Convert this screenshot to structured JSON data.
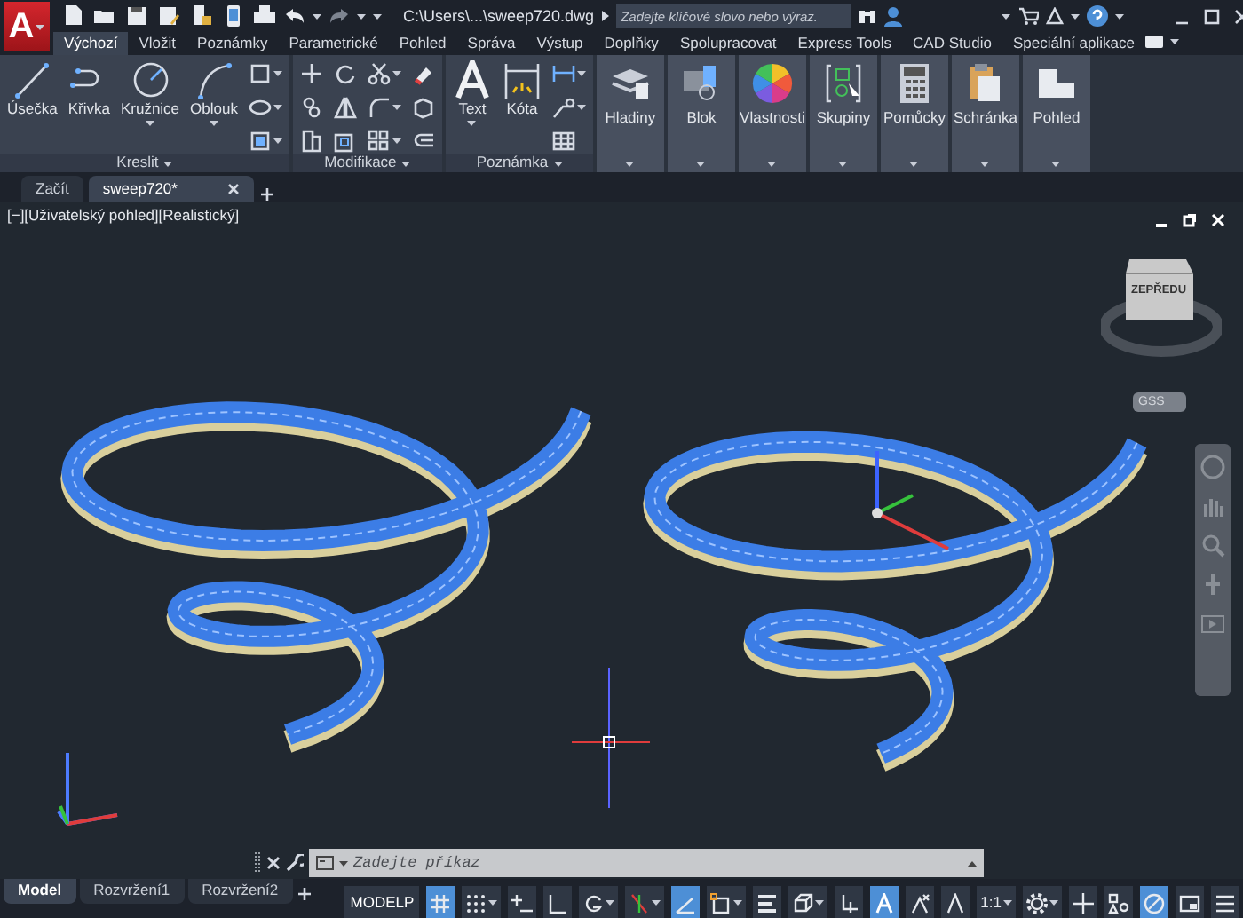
{
  "title_bar": {
    "app_button": {
      "label": "A"
    },
    "title": "C:\\Users\\...\\sweep720.dwg",
    "search": {
      "placeholder": "Zadejte klíčové slovo nebo výraz."
    }
  },
  "ribbon_tabs": [
    {
      "label": "Výchozí",
      "selected": true
    },
    {
      "label": "Vložit",
      "selected": false
    },
    {
      "label": "Poznámky",
      "selected": false
    },
    {
      "label": "Parametrické",
      "selected": false
    },
    {
      "label": "Pohled",
      "selected": false
    },
    {
      "label": "Správa",
      "selected": false
    },
    {
      "label": "Výstup",
      "selected": false
    },
    {
      "label": "Doplňky",
      "selected": false
    },
    {
      "label": "Spolupracovat",
      "selected": false
    },
    {
      "label": "Express Tools",
      "selected": false
    },
    {
      "label": "CAD Studio",
      "selected": false
    },
    {
      "label": "Speciální aplikace",
      "selected": false
    }
  ],
  "ribbon_panels": [
    {
      "kind": "draw",
      "title": "Kreslit",
      "large_tools": [
        {
          "label": "Úsečka",
          "menu": false
        },
        {
          "label": "Křivka",
          "menu": false
        },
        {
          "label": "Kružnice",
          "menu": true
        },
        {
          "label": "Oblouk",
          "menu": true
        }
      ]
    },
    {
      "kind": "modify",
      "title": "Modifikace"
    },
    {
      "kind": "annotate",
      "title": "Poznámka",
      "large_tools": [
        {
          "label": "Text",
          "menu": true
        },
        {
          "label": "Kóta",
          "menu": false
        }
      ]
    }
  ],
  "collapsed_panels": [
    {
      "label": "Hladiny"
    },
    {
      "label": "Blok"
    },
    {
      "label": "Vlastnosti"
    },
    {
      "label": "Skupiny"
    },
    {
      "label": "Pomůcky"
    },
    {
      "label": "Schránka"
    },
    {
      "label": "Pohled"
    }
  ],
  "document_tabs": [
    {
      "label": "Začít",
      "selected": false
    },
    {
      "label": "sweep720*",
      "selected": true
    }
  ],
  "viewport": {
    "label": "[−][Uživatelský pohled][Realistický]",
    "view_cube": {
      "face": "ZEPŘEDU"
    },
    "ucs_menu": "GSS"
  },
  "command_line": {
    "placeholder": "Zadejte příkaz"
  },
  "layout_tabs": [
    {
      "label": "Model",
      "selected": true
    },
    {
      "label": "Rozvržení1",
      "selected": false
    },
    {
      "label": "Rozvržení2",
      "selected": false
    }
  ],
  "status_bar": {
    "space": "MODELP",
    "scale": "1:1",
    "toggles": [
      {
        "on": true
      },
      {
        "on": false
      },
      {
        "on": false
      },
      {
        "on": false
      },
      {
        "on": false
      },
      {
        "on": false
      },
      {
        "on": true
      },
      {
        "on": false
      },
      {
        "on": false
      },
      {
        "on": false
      },
      {
        "on": false
      },
      {
        "on": true
      },
      {
        "on": false
      },
      {
        "on": false
      },
      {
        "on": false
      },
      {
        "on": false
      },
      {
        "on": false
      },
      {
        "on": true
      },
      {
        "on": false
      },
      {
        "on": false
      }
    ]
  }
}
